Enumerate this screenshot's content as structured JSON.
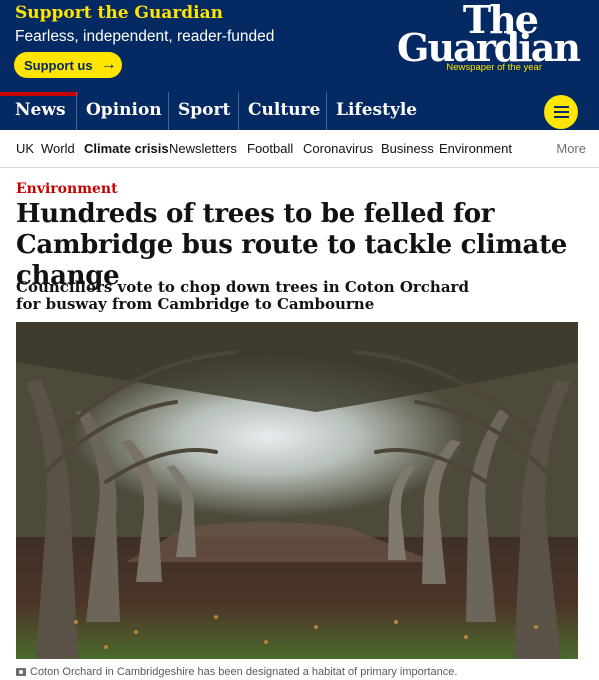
{
  "header": {
    "support_title": "Support the Guardian",
    "support_subtitle": "Fearless, independent, reader-funded",
    "support_button": "Support us",
    "logo_line1": "The",
    "logo_line2": "Guardian",
    "logo_tagline": "Newspaper of the year"
  },
  "pillars": [
    "News",
    "Opinion",
    "Sport",
    "Culture",
    "Lifestyle"
  ],
  "subnav": [
    "UK",
    "World",
    "Climate crisis",
    "Newsletters",
    "Football",
    "Coronavirus",
    "Business",
    "Environment"
  ],
  "subnav_more": "More",
  "article": {
    "kicker": "Environment",
    "headline": "Hundreds of trees to be felled for Cambridge bus route to tackle climate change",
    "standfirst": "Councillors vote to chop down trees in Coton Orchard for busway from Cambridge to Cambourne",
    "caption": "Coton Orchard in Cambridgeshire has been designated a habitat of primary importance."
  },
  "colors": {
    "brand_blue": "#052962",
    "support_yellow": "#ffe500",
    "news_red": "#c70000"
  },
  "icons": [
    "arrow-right-icon",
    "menu-icon",
    "camera-icon"
  ]
}
